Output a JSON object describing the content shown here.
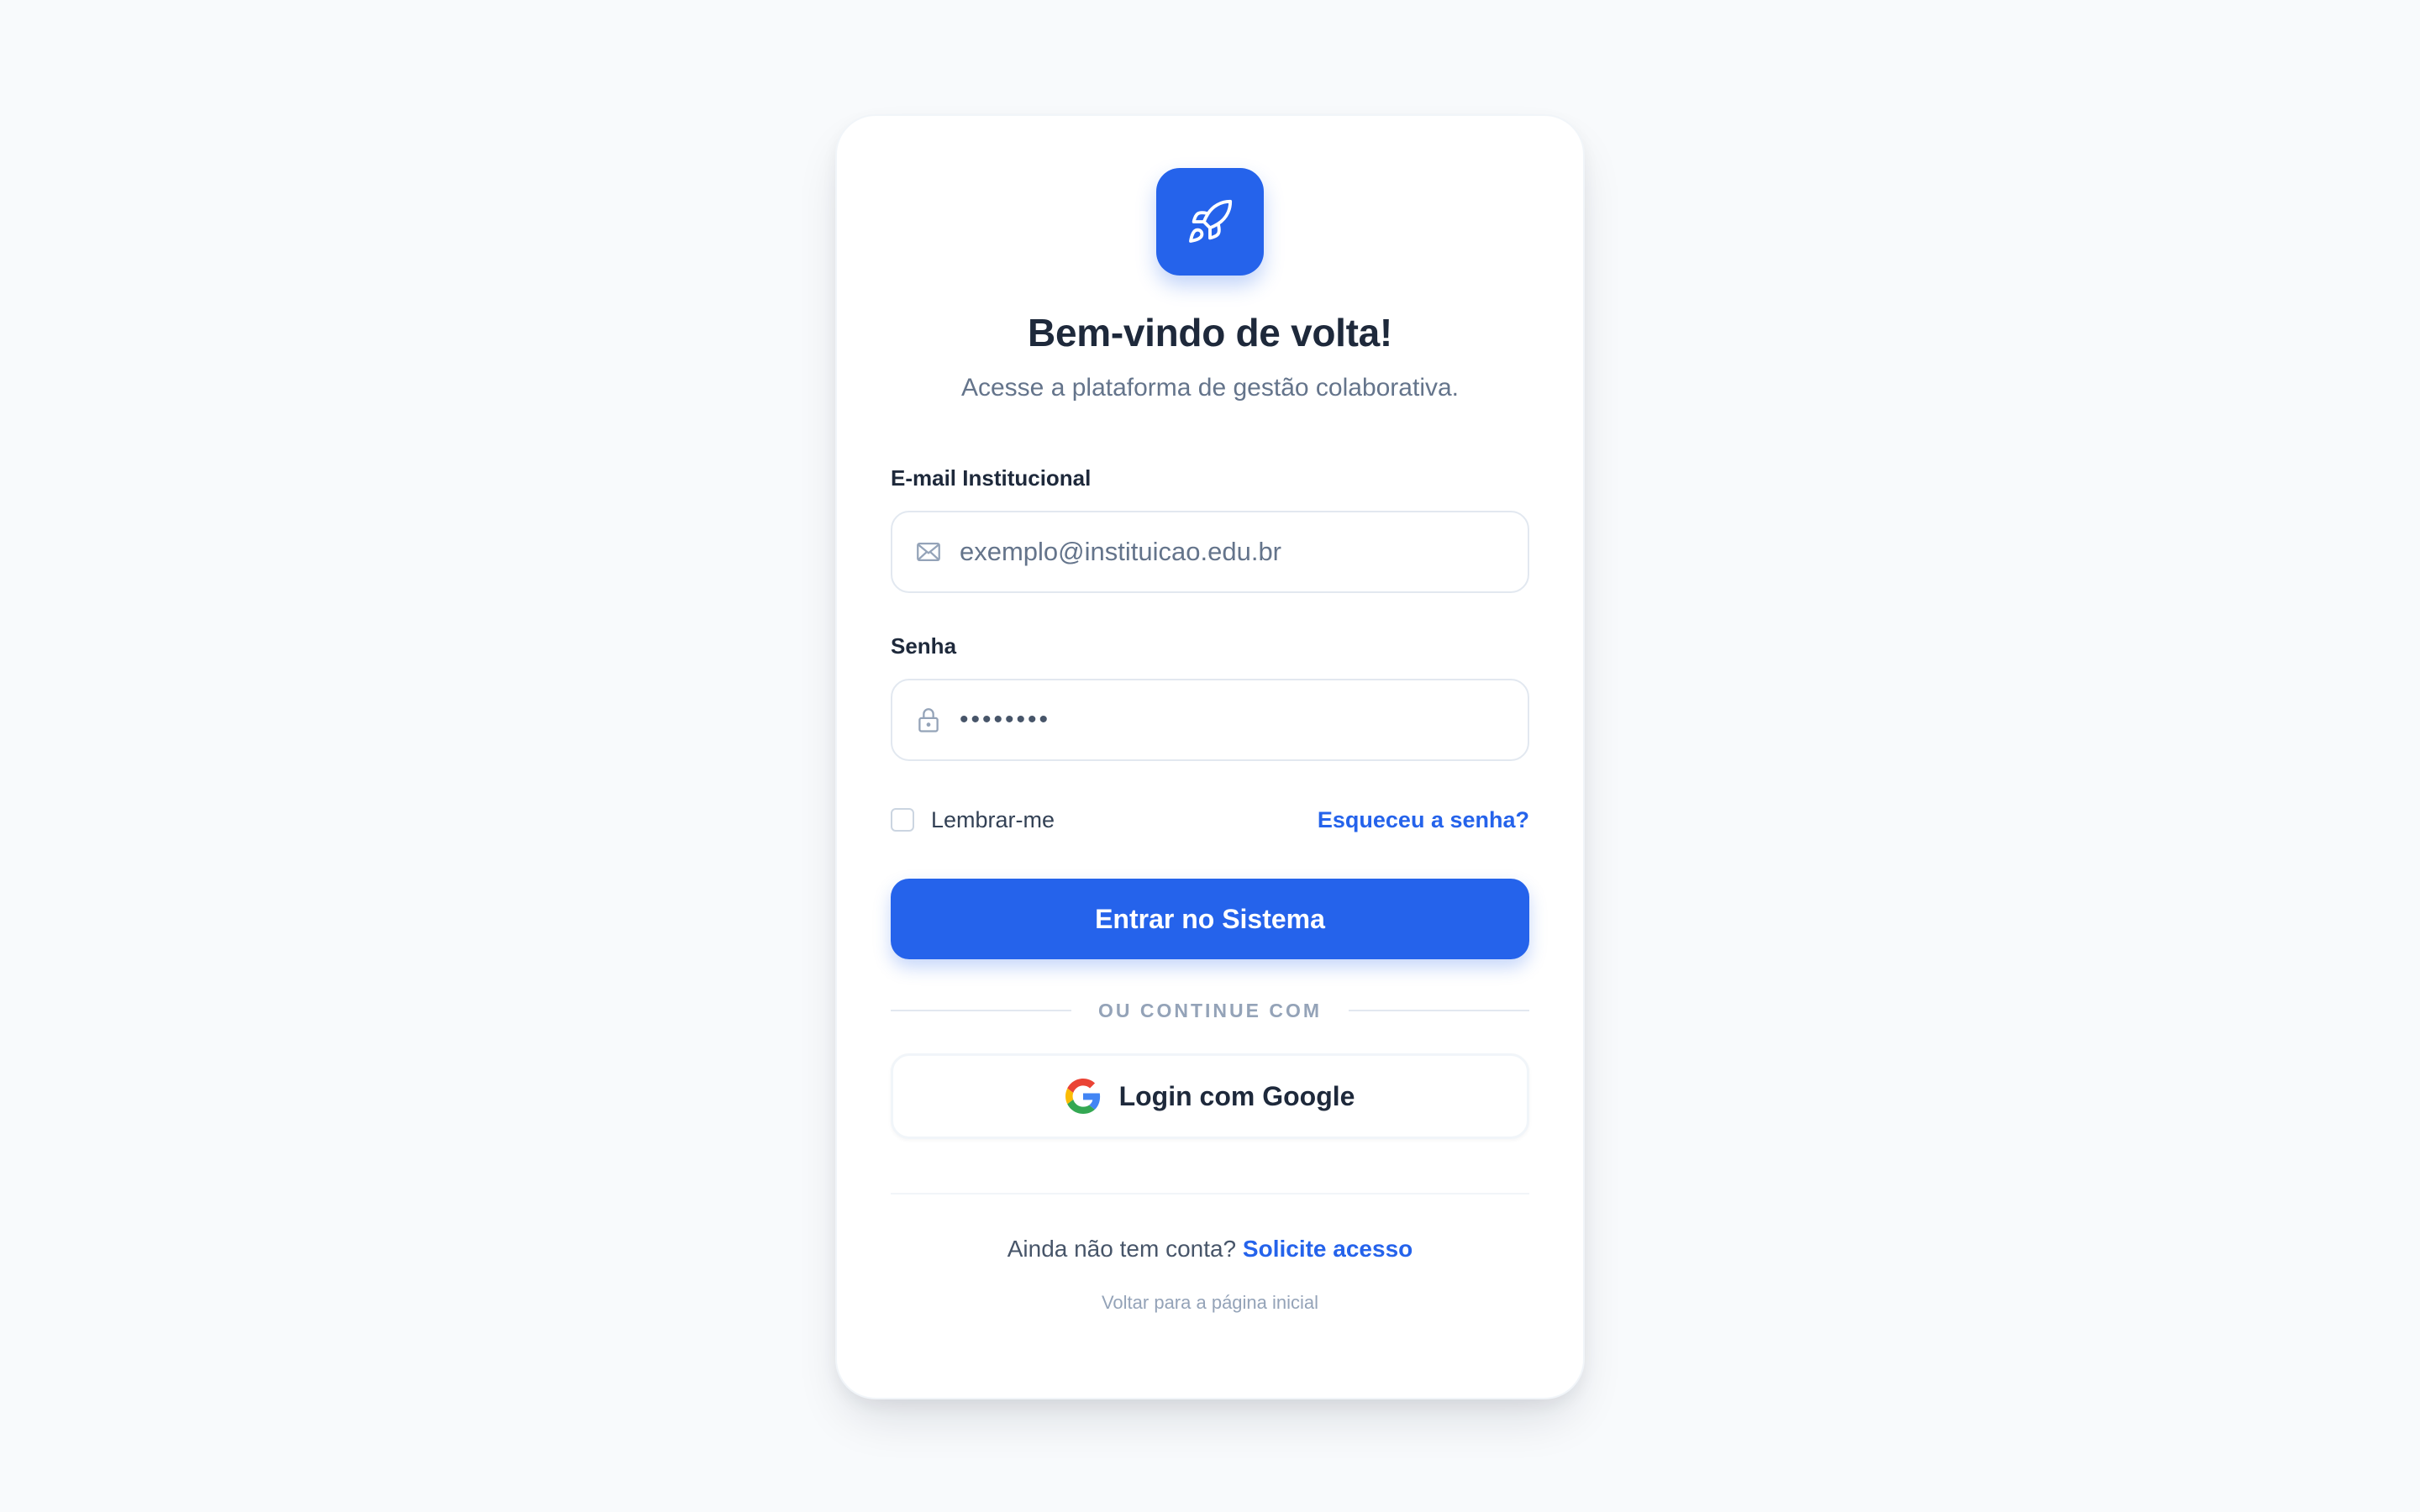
{
  "header": {
    "title": "Bem-vindo de volta!",
    "subtitle": "Acesse a plataforma de gestão colaborativa."
  },
  "icons": {
    "logo": "rocket-icon",
    "email": "mail-icon",
    "password": "lock-icon",
    "google": "google-logo-icon"
  },
  "form": {
    "email_label": "E-mail Institucional",
    "email_placeholder": "exemplo@instituicao.edu.br",
    "password_label": "Senha",
    "password_value": "••••••••",
    "remember_label": "Lembrar-me",
    "remember_checked": false,
    "forgot_label": "Esqueceu a senha?",
    "submit_label": "Entrar no Sistema"
  },
  "social": {
    "divider_text": "OU CONTINUE COM",
    "google_label": "Login com Google"
  },
  "footer": {
    "signup_prompt": "Ainda não tem conta?",
    "signup_link": "Solicite acesso",
    "back_link": "Voltar para a página inicial"
  },
  "colors": {
    "primary": "#2563eb",
    "background": "#f8fafc",
    "card": "#ffffff",
    "heading": "#1e293b",
    "muted": "#64748b"
  }
}
